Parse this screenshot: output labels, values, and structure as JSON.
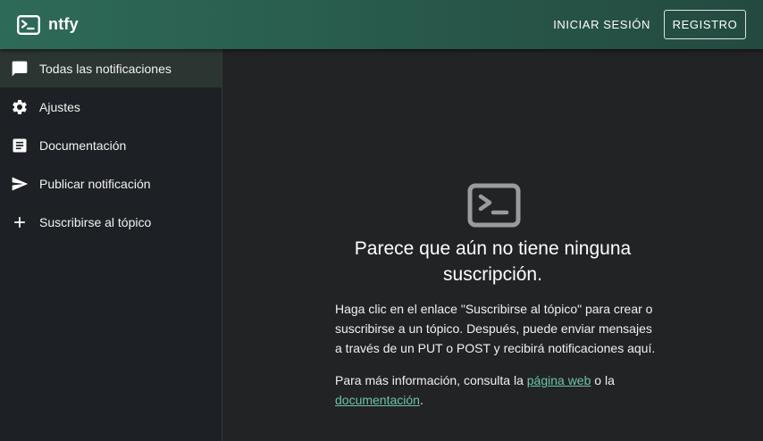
{
  "app": {
    "name": "ntfy",
    "logo_icon": "terminal-icon",
    "accent": "#2e6a58"
  },
  "header": {
    "login_label": "INICIAR SESIÓN",
    "register_label": "REGISTRO"
  },
  "sidebar": {
    "items": [
      {
        "label": "Todas las notificaciones",
        "icon": "chat-bubble-icon",
        "active": true
      },
      {
        "label": "Ajustes",
        "icon": "gear-icon"
      },
      {
        "label": "Documentación",
        "icon": "document-icon"
      },
      {
        "label": "Publicar notificación",
        "icon": "send-icon"
      },
      {
        "label": "Suscribirse al tópico",
        "icon": "plus-icon"
      }
    ]
  },
  "main": {
    "empty_icon": "terminal-icon",
    "title_line1": "Parece que aún no tiene ninguna",
    "title_line2": "suscripción.",
    "paragraph1_line1": "Haga clic en el enlace \"Suscribirse al tópico\" para crear o",
    "paragraph1_line2": "suscribirse a un tópico. Después, puede enviar mensajes",
    "paragraph1_line3": "a través de un PUT o POST y recibirá notificaciones aquí.",
    "paragraph2_prefix": "Para más información, consulta la ",
    "paragraph2_link1": "página web",
    "paragraph2_middle": " o la",
    "paragraph2_link2": "documentación",
    "paragraph2_suffix": "."
  }
}
